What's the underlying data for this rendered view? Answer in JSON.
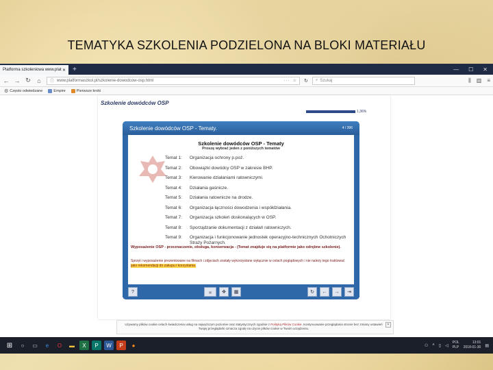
{
  "slide_title": "TEMATYKA SZKOLENIA PODZIELONA NA BLOKI MATERIAŁU",
  "browser": {
    "tab_title": "Platforma szkoleniowa www.plat",
    "url": "www.platformaszkol.pl/szkolenie-dowodcow-osp.html",
    "search_placeholder": "Szukaj",
    "bookmarks": [
      "Często odwiedzane",
      "Empire",
      "Pierwsze kroki"
    ]
  },
  "course": {
    "title": "Szkolenie dowódców OSP",
    "progress_percent": 1.36,
    "progress_text": "1,36%"
  },
  "player": {
    "header_title": "Szkolenie dowódców OSP - Tematy.",
    "page_counter": "4 / 396",
    "heading": "Szkolenie dowódców OSP - Tematy",
    "subheading": "Proszę wybrać jeden z poniższych tematów",
    "topics": [
      {
        "label": "Temat 1:",
        "text": "Organizacja ochrony p.poż."
      },
      {
        "label": "Temat 2:",
        "text": "Obowiązki dowódcy OSP w zakresie BHP."
      },
      {
        "label": "Temat 3:",
        "text": "Kierowanie działaniami ratowniczymi."
      },
      {
        "label": "Temat 4:",
        "text": "Działania gaśnicze."
      },
      {
        "label": "Temat 5:",
        "text": "Działania ratownicze na drodze."
      },
      {
        "label": "Temat 6:",
        "text": "Organizacja łączności dowodzenia i współdziałania."
      },
      {
        "label": "Temat 7:",
        "text": "Organizacja szkoleń doskonalących w OSP."
      },
      {
        "label": "Temat 8:",
        "text": "Sporządzanie dokumentacji z działań ratowniczych."
      },
      {
        "label": "Temat 9:",
        "text": "Organizacja i funkcjonowanie jednostek operacyjno-technicznych Ochotniczych Straży Pożarnych."
      }
    ],
    "notice": "Wyposażenie OSP - przeznaczenie, obsługa, konserwacja - (Temat znajduje się na platformie jako odrębne szkolenie).",
    "desc_part1": "Sprzęt i wyposażenie prezentowane na filmach i zdjęciach zostały wykorzystane wyłącznie w celach poglądowych i nie należy tego traktować ",
    "desc_highlight": "jako rekomendacji do zakupu i korzystania."
  },
  "cookie": {
    "text": "Używamy plików cookie celach świadczenia usług na najwyższym poziomie oraz statystycznych zgodnie z ",
    "link": "Polityką Plików Cookie",
    "text2": ". Kontynuowanie przeglądania stronie bez zmiany ustawień Twojej przeglądarki oznacza zgodę na użycie plików cookie w Twoim urządzeniu."
  },
  "taskbar": {
    "lang_top": "POL",
    "lang_bottom": "PLP",
    "time": "13:01",
    "date": "2018-01-30"
  },
  "colors": {
    "browser_tabbar": "#1f2a44",
    "player_blue": "#2e68a8",
    "notice_red": "#7a1a1a",
    "highlight": "#ffd84a"
  }
}
